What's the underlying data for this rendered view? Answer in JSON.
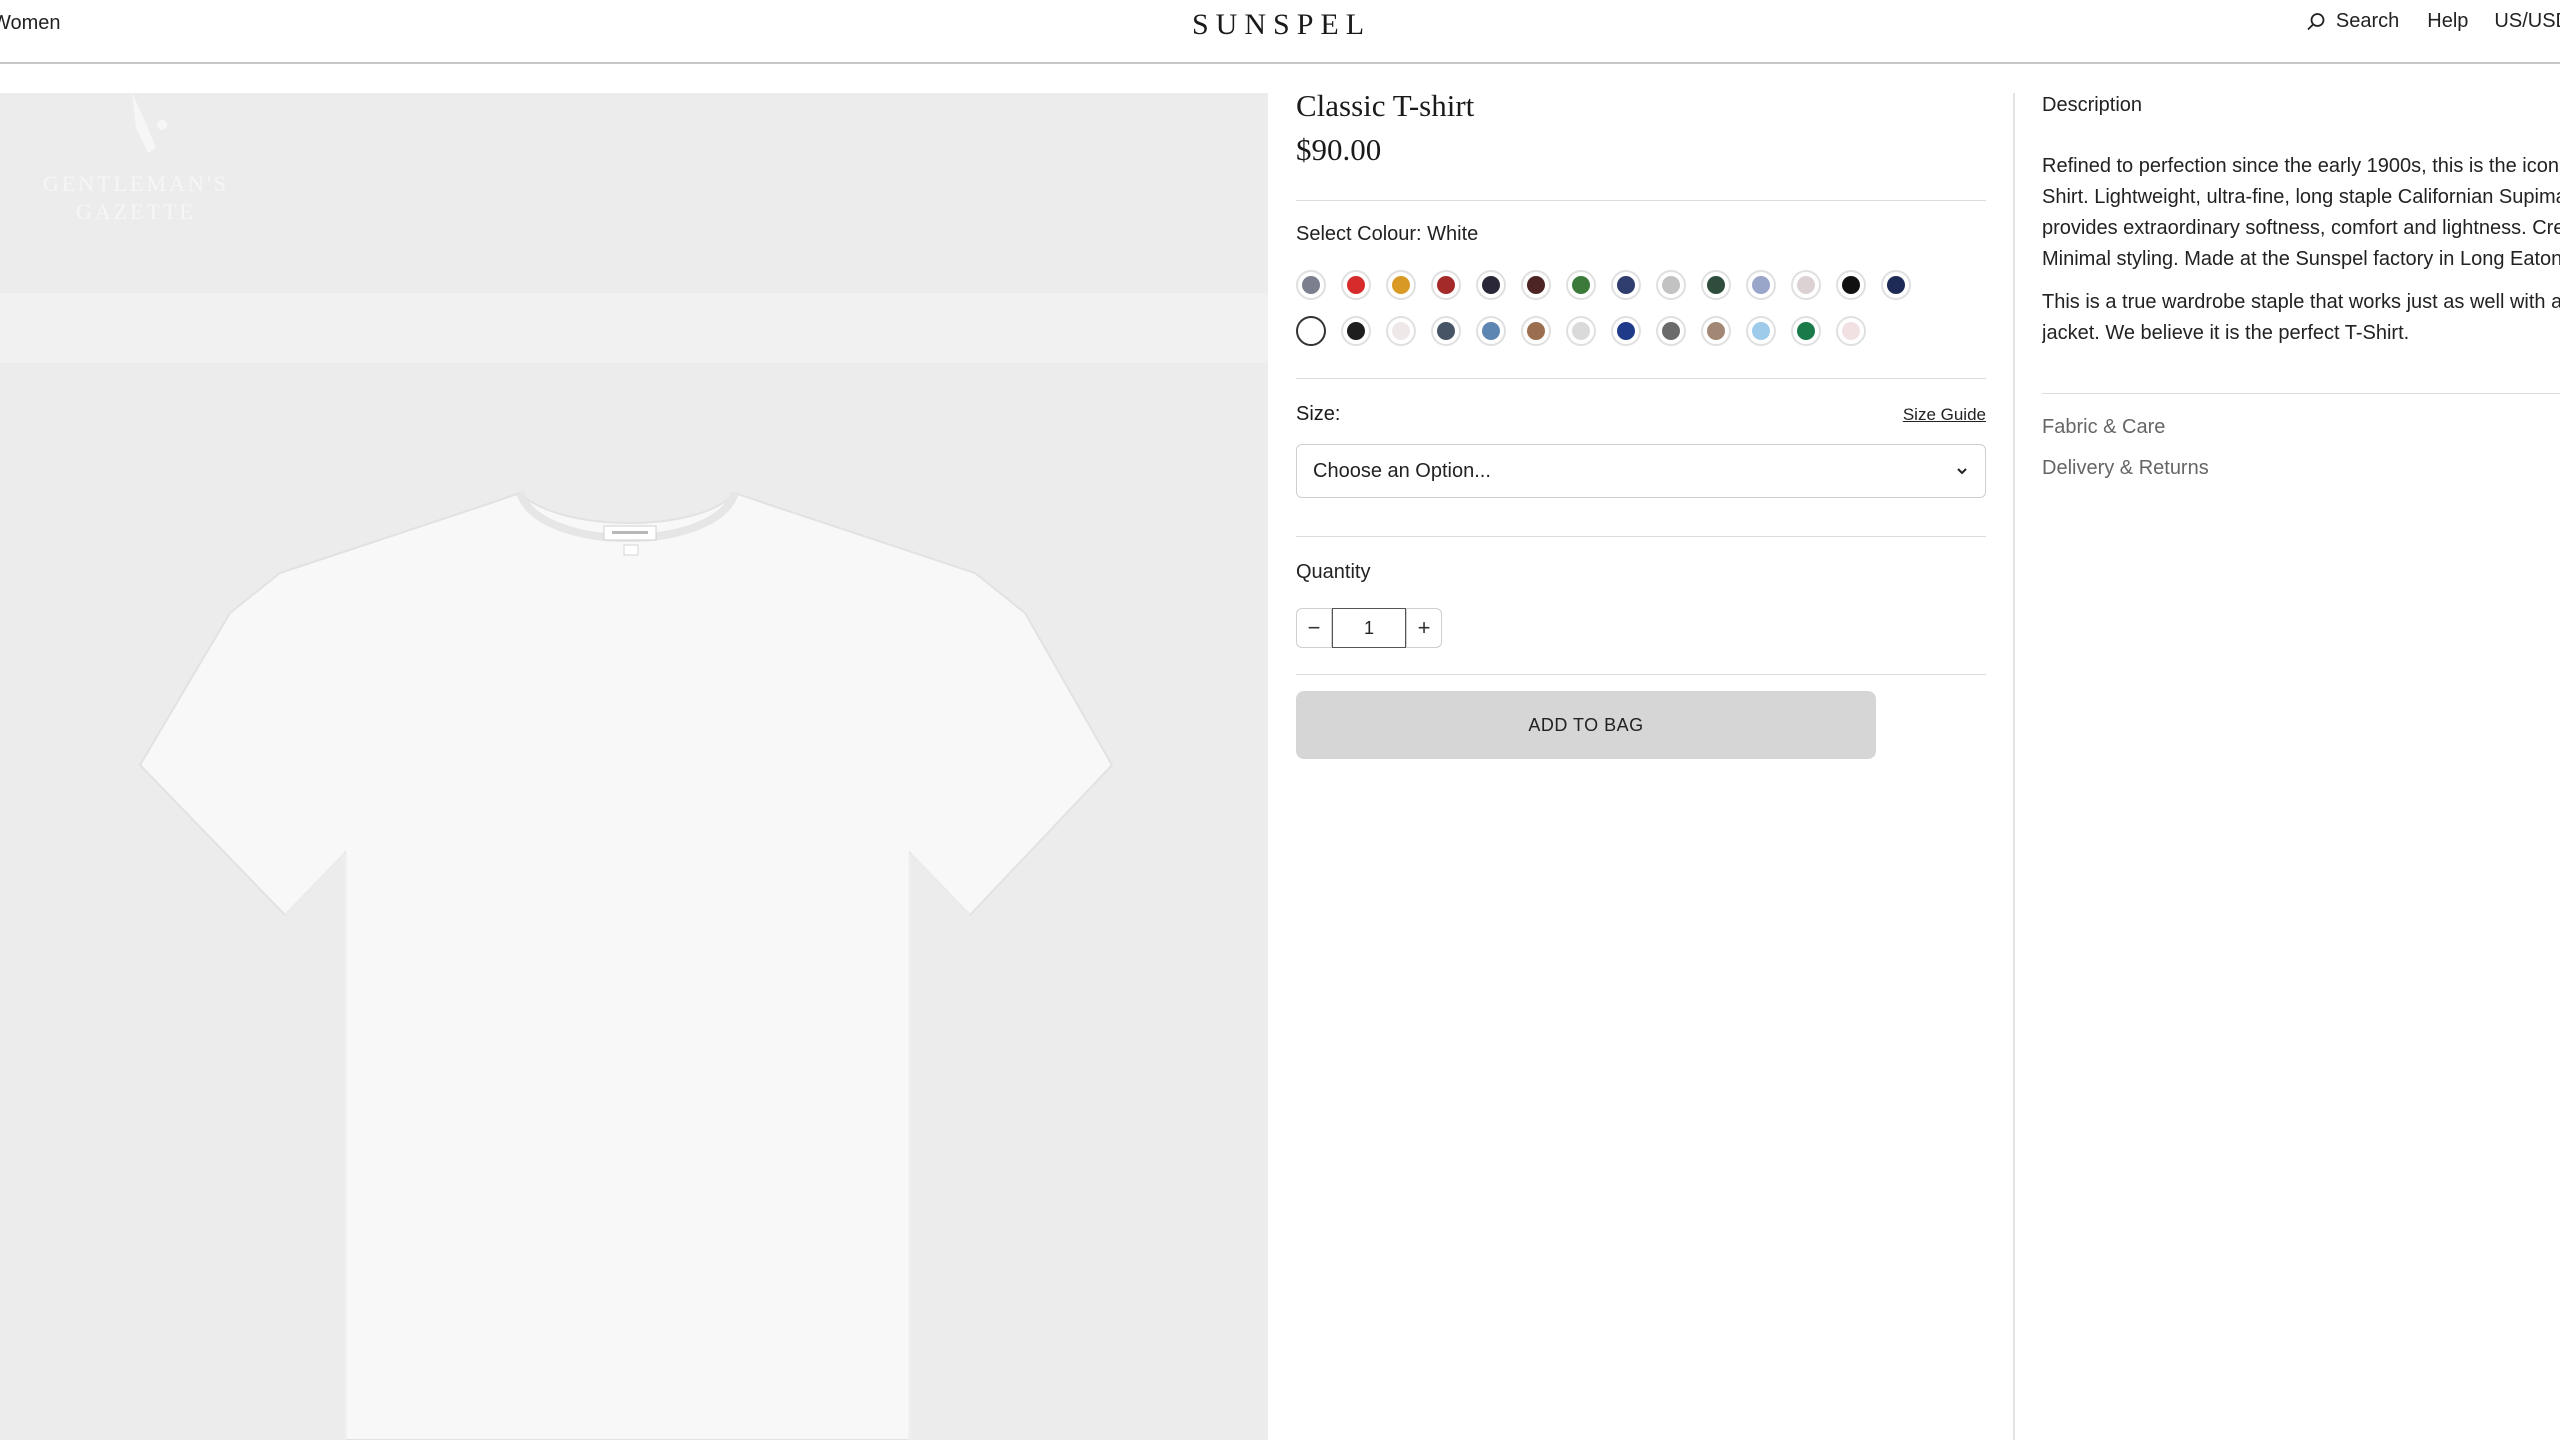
{
  "header": {
    "nav_women": "Women",
    "logo": "SUNSPEL",
    "search_label": "Search",
    "help_label": "Help",
    "region_label": "US/USD"
  },
  "image": {
    "watermark_line1": "GENTLEMAN'S",
    "watermark_line2": "GAZETTE"
  },
  "product": {
    "title": "Classic T-shirt",
    "price": "$90.00",
    "colour_label": "Select Colour: White",
    "selected_colour": "White",
    "swatches": [
      "#7b7f8e",
      "#d62b2b",
      "#d99a25",
      "#a42a2a",
      "#2a2838",
      "#4d2424",
      "#3b7a3a",
      "#2f3e6e",
      "#c2c2c2",
      "#2e4d3c",
      "#9aa6c9",
      "#dcd2d4",
      "#111111",
      "#1c2a55",
      "#ffffff",
      "#1e1e1e",
      "#efe8e8",
      "#465466",
      "#5e86b3",
      "#9b6e50",
      "#dadada",
      "#203a8a",
      "#6b6b6b",
      "#a28874",
      "#9fcbea",
      "#1b7a4a",
      "#f2e1e2"
    ],
    "size_label": "Size:",
    "size_guide_label": "Size Guide",
    "size_select_value": "Choose an Option...",
    "quantity_label": "Quantity",
    "quantity_value": "1",
    "minus_label": "−",
    "plus_label": "+",
    "add_to_bag_label": "ADD TO BAG"
  },
  "details": {
    "description_title": "Description",
    "description_lines_1": [
      "Refined to perfection since the early 1900s, this is the iconic Sunspel T-",
      "Shirt. Lightweight, ultra-fine, long staple Californian Supima cotton",
      "provides extraordinary softness, comfort and lightness. Crew neck.",
      "Minimal styling. Made at the Sunspel factory in Long Eaton, England."
    ],
    "description_lines_2": [
      "This is a true wardrobe staple that works just as well with a tailored",
      "jacket. We believe it is the perfect T-Shirt."
    ],
    "fabric_care_label": "Fabric & Care",
    "delivery_returns_label": "Delivery & Returns"
  },
  "colors": {
    "accent": "#1a1a1a",
    "button_bg": "#d6d6d6",
    "image_bg": "#ececec"
  }
}
